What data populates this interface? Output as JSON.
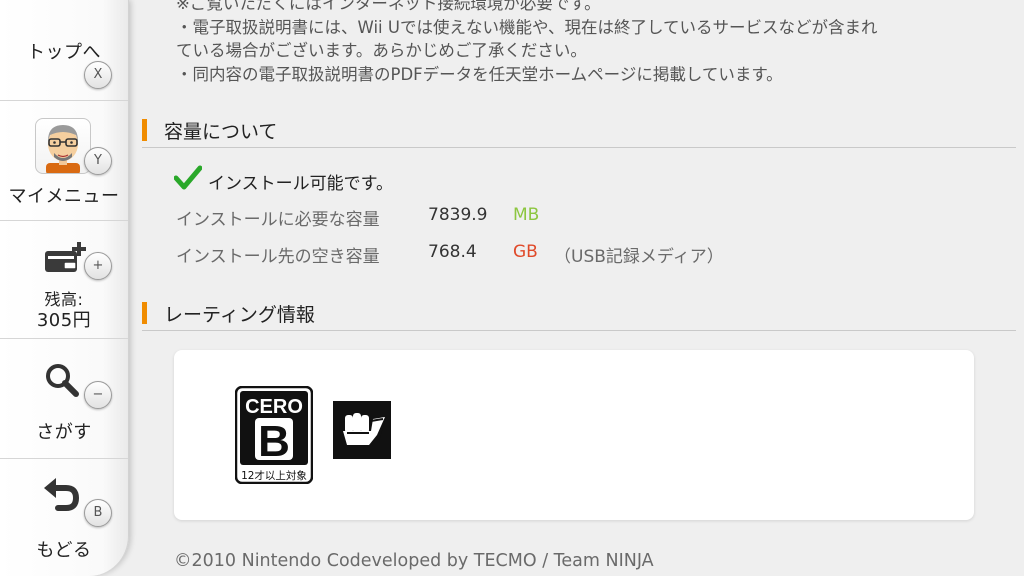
{
  "sidebar": {
    "top": {
      "label": "トップへ",
      "button": "X"
    },
    "mymenu": {
      "label": "マイメニュー",
      "button": "Y"
    },
    "balance": {
      "label_line1": "残高:",
      "label_line2": "305円",
      "button": "+"
    },
    "search": {
      "label": "さがす",
      "button": "−"
    },
    "back": {
      "label": "もどる",
      "button": "B"
    }
  },
  "intro": {
    "line1": "※ご覧いただくにはインターネット接続環境が必要です。",
    "line2": "・電子取扱説明書には、Wii Uでは使えない機能や、現在は終了しているサービスなどが含まれ",
    "line3": "ている場合がございます。あらかじめご了承ください。",
    "line4": "・同内容の電子取扱説明書のPDFデータを任天堂ホームページに掲載しています。"
  },
  "capacity": {
    "title": "容量について",
    "status": "インストール可能です。",
    "required": {
      "label": "インストールに必要な容量",
      "value": "7839.9",
      "unit": "MB",
      "unit_color": "#8cc63f"
    },
    "free": {
      "label": "インストール先の空き容量",
      "value": "768.4",
      "unit": "GB",
      "unit_color": "#e04a2a",
      "note": "（USB記録メディア）"
    }
  },
  "rating": {
    "title": "レーティング情報",
    "cero_text": "CERO",
    "cero_grade": "B",
    "cero_age": "12才以上対象",
    "descriptor_icon": "violence-fist-icon"
  },
  "copyright": "©2010 Nintendo Codeveloped by TECMO / Team NINJA",
  "colors": {
    "accent": "#f08c00",
    "check": "#2aa82a"
  }
}
